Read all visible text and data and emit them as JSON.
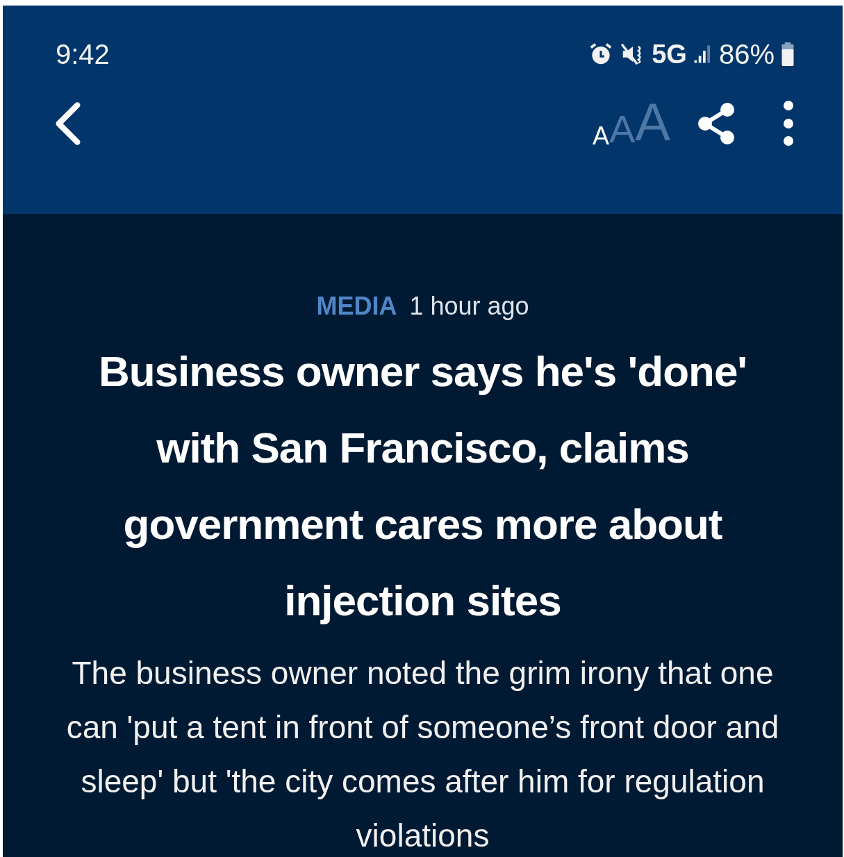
{
  "status_bar": {
    "time": "9:42",
    "network": "5G",
    "battery": "86%"
  },
  "toolbar": {
    "font_sizes": [
      {
        "label": "A",
        "selected": true
      },
      {
        "label": "A",
        "selected": false
      },
      {
        "label": "A",
        "selected": false
      }
    ]
  },
  "article": {
    "category": "MEDIA",
    "time": "1 hour ago",
    "headline": "Business owner says he's 'done' with San Francisco, claims government cares more about injection sites",
    "subtitle": "The business owner noted the grim irony that one can 'put a tent in front of someone’s front door and sleep' but 'the city comes after him for regulation violations"
  }
}
